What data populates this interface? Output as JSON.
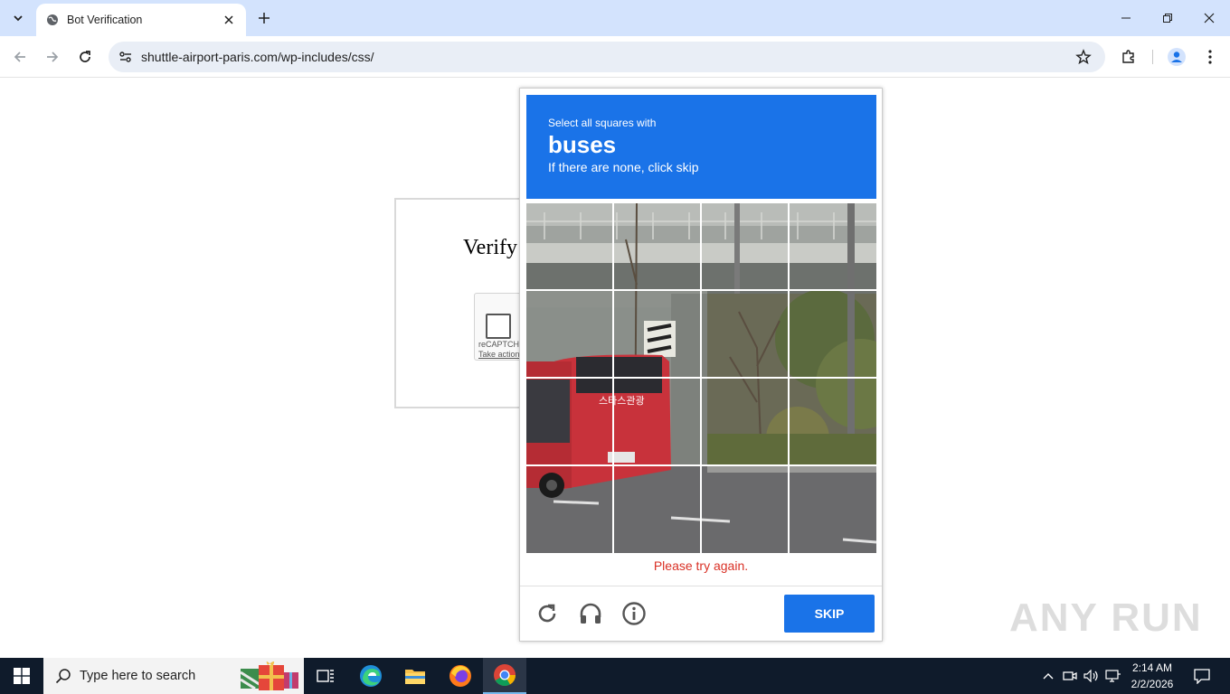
{
  "browser": {
    "tab_title": "Bot Verification",
    "url": "shuttle-airport-paris.com/wp-includes/css/"
  },
  "page": {
    "heading": "Verify",
    "recaptcha_label": "reCAPTCHA",
    "recaptcha_link": "Take action"
  },
  "challenge": {
    "instruction": "Select all squares with",
    "target": "buses",
    "subtitle": "If there are none, click skip",
    "error": "Please try again.",
    "skip_label": "SKIP",
    "grid_rows": 4,
    "grid_cols": 4
  },
  "watermark": "ANY RUN",
  "taskbar": {
    "search_placeholder": "Type here to search",
    "time": "2:14 AM",
    "date": "2/2/2026"
  },
  "colors": {
    "challenge_header": "#1a73e8",
    "error": "#d93025",
    "tabstrip": "#d3e3fd",
    "taskbar": "#0f1b2b"
  }
}
